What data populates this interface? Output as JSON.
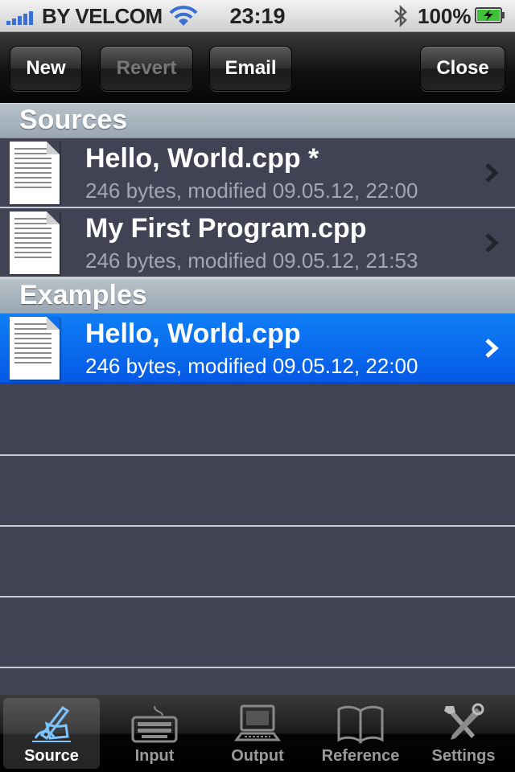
{
  "status_bar": {
    "carrier": "BY VELCOM",
    "time": "23:19",
    "battery": "100%"
  },
  "toolbar": {
    "new_label": "New",
    "revert_label": "Revert",
    "email_label": "Email",
    "close_label": "Close"
  },
  "sections": [
    {
      "title": "Sources",
      "items": [
        {
          "name": "Hello, World.cpp *",
          "detail": "246 bytes, modified 09.05.12, 22:00"
        },
        {
          "name": "My First Program.cpp",
          "detail": "246 bytes, modified 09.05.12, 21:53"
        }
      ]
    },
    {
      "title": "Examples",
      "items": [
        {
          "name": "Hello, World.cpp",
          "detail": "246 bytes, modified 09.05.12, 22:00",
          "selected": true
        }
      ]
    }
  ],
  "tabs": [
    {
      "label": "Source",
      "icon": "pen-hand-icon",
      "active": true
    },
    {
      "label": "Input",
      "icon": "keyboard-icon"
    },
    {
      "label": "Output",
      "icon": "computer-icon"
    },
    {
      "label": "Reference",
      "icon": "book-icon"
    },
    {
      "label": "Settings",
      "icon": "tools-icon"
    }
  ],
  "colors": {
    "list_background": "#414254",
    "selection": "#0a6cf0",
    "section_header": "#a9b4bd"
  }
}
